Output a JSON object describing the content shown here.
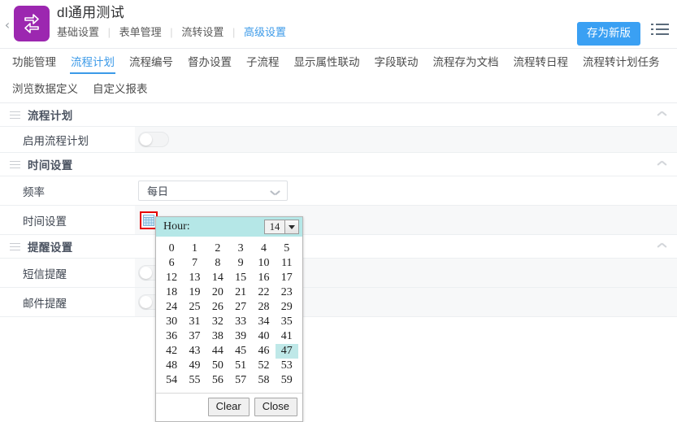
{
  "header": {
    "back_label": "‹",
    "logo_icon": "sync-arrows-icon",
    "logo_color": "#9c27b0",
    "title": "dl通用测试",
    "crumbs": [
      {
        "label": "基础设置",
        "active": false
      },
      {
        "label": "表单管理",
        "active": false
      },
      {
        "label": "流转设置",
        "active": false
      },
      {
        "label": "高级设置",
        "active": true
      }
    ],
    "save_label": "存为新版",
    "save_color": "#3aa0f3",
    "list_icon": "list-menu-icon"
  },
  "tabs": [
    {
      "label": "功能管理",
      "active": false
    },
    {
      "label": "流程计划",
      "active": true
    },
    {
      "label": "流程编号",
      "active": false
    },
    {
      "label": "督办设置",
      "active": false
    },
    {
      "label": "子流程",
      "active": false
    },
    {
      "label": "显示属性联动",
      "active": false
    },
    {
      "label": "字段联动",
      "active": false
    },
    {
      "label": "流程存为文档",
      "active": false
    },
    {
      "label": "流程转日程",
      "active": false
    },
    {
      "label": "流程转计划任务",
      "active": false
    },
    {
      "label": "浏览数据定义",
      "active": false
    },
    {
      "label": "自定义报表",
      "active": false
    }
  ],
  "sections": [
    {
      "title": "流程计划",
      "grip_icon": "drag-grip-icon",
      "collapse_icon": "chevron-up-icon",
      "rows": [
        {
          "label": "启用流程计划",
          "control": "toggle",
          "value": "off"
        }
      ]
    },
    {
      "title": "时间设置",
      "grip_icon": "drag-grip-icon",
      "collapse_icon": "chevron-up-icon",
      "rows": [
        {
          "label": "频率",
          "control": "select",
          "value": "每日",
          "chevron_icon": "chevron-down-icon"
        },
        {
          "label": "时间设置",
          "control": "calendar",
          "icon": "calendar-icon",
          "focus_color": "#e60000"
        }
      ]
    },
    {
      "title": "提醒设置",
      "grip_icon": "drag-grip-icon",
      "collapse_icon": "chevron-up-icon",
      "rows": [
        {
          "label": "短信提醒",
          "control": "toggle",
          "value": "off"
        },
        {
          "label": "邮件提醒",
          "control": "toggle",
          "value": "off"
        }
      ]
    }
  ],
  "time_picker": {
    "hour_label": "Hour:",
    "hour_value": "14",
    "hour_dropdown_icon": "triangle-down-icon",
    "header_color": "#b5e7e7",
    "selected_minute": "47",
    "selected_minute_color": "#bfe8e8",
    "minutes": [
      [
        "0",
        "1",
        "2",
        "3",
        "4",
        "5"
      ],
      [
        "6",
        "7",
        "8",
        "9",
        "10",
        "11"
      ],
      [
        "12",
        "13",
        "14",
        "15",
        "16",
        "17"
      ],
      [
        "18",
        "19",
        "20",
        "21",
        "22",
        "23"
      ],
      [
        "24",
        "25",
        "26",
        "27",
        "28",
        "29"
      ],
      [
        "30",
        "31",
        "32",
        "33",
        "34",
        "35"
      ],
      [
        "36",
        "37",
        "38",
        "39",
        "40",
        "41"
      ],
      [
        "42",
        "43",
        "44",
        "45",
        "46",
        "47"
      ],
      [
        "48",
        "49",
        "50",
        "51",
        "52",
        "53"
      ],
      [
        "54",
        "55",
        "56",
        "57",
        "58",
        "59"
      ]
    ],
    "clear_label": "Clear",
    "close_label": "Close"
  }
}
